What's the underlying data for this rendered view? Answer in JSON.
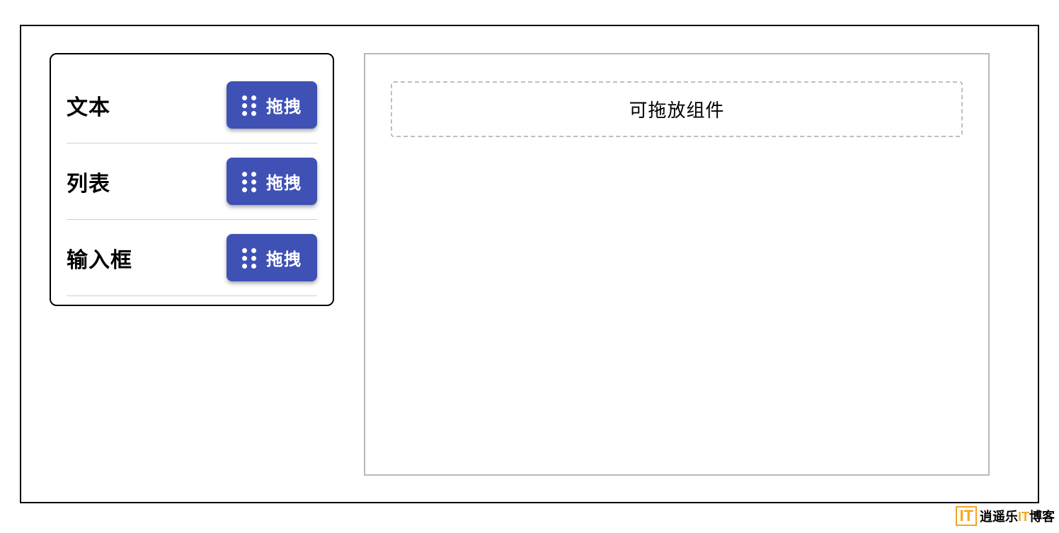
{
  "sidebar": {
    "components": [
      {
        "label": "文本",
        "drag_label": "拖拽"
      },
      {
        "label": "列表",
        "drag_label": "拖拽"
      },
      {
        "label": "输入框",
        "drag_label": "拖拽"
      }
    ]
  },
  "canvas": {
    "drop_zone_label": "可拖放组件"
  },
  "watermark": {
    "icon": "IT",
    "prefix": "逍遥乐",
    "highlight": "IT",
    "suffix": "博客"
  }
}
